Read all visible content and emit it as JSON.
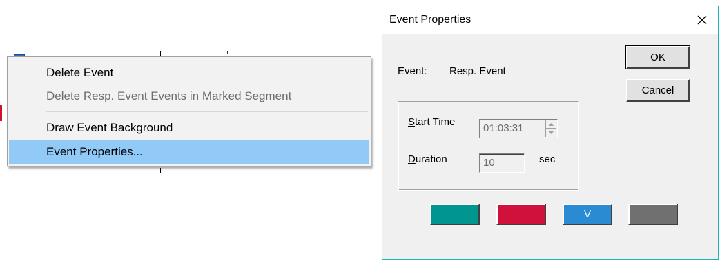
{
  "context_menu": {
    "items": [
      {
        "label": "Delete Event",
        "enabled": true
      },
      {
        "label": "Delete Resp. Event Events in Marked Segment",
        "enabled": false
      },
      {
        "label": "Draw Event Background",
        "enabled": true
      },
      {
        "label": "Event Properties...",
        "enabled": true,
        "highlighted": true
      }
    ]
  },
  "dialog": {
    "title": "Event Properties",
    "close_icon": "close-icon",
    "event_label": "Event:",
    "event_value": "Resp. Event",
    "ok_label": "OK",
    "cancel_label": "Cancel",
    "start_time": {
      "label": "Start Time",
      "value": "01:03:31"
    },
    "duration": {
      "label": "Duration",
      "value": "10",
      "unit": "sec"
    },
    "swatches": [
      {
        "color": "#00958f",
        "label": ""
      },
      {
        "color": "#d0113b",
        "label": ""
      },
      {
        "color": "#2a8ad2",
        "label": "V"
      },
      {
        "color": "#707070",
        "label": ""
      }
    ]
  }
}
